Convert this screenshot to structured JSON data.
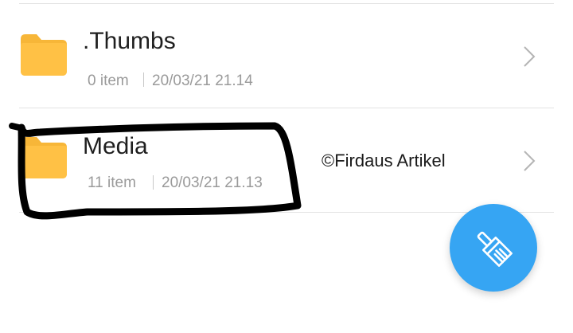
{
  "file_list": {
    "items": [
      {
        "name": ".Thumbs",
        "count": "0 item",
        "modified": "20/03/21 21.14",
        "icon": "folder-icon"
      },
      {
        "name": "Media",
        "count": "11 item",
        "modified": "20/03/21 21.13",
        "icon": "folder-icon"
      }
    ]
  },
  "watermark": "©Firdaus Artikel",
  "fab": {
    "icon": "clean-brush-icon",
    "color": "#36a5f3"
  },
  "colors": {
    "folder": "#ffc145",
    "folder_tab": "#f7b638",
    "annotation": "#000000"
  }
}
